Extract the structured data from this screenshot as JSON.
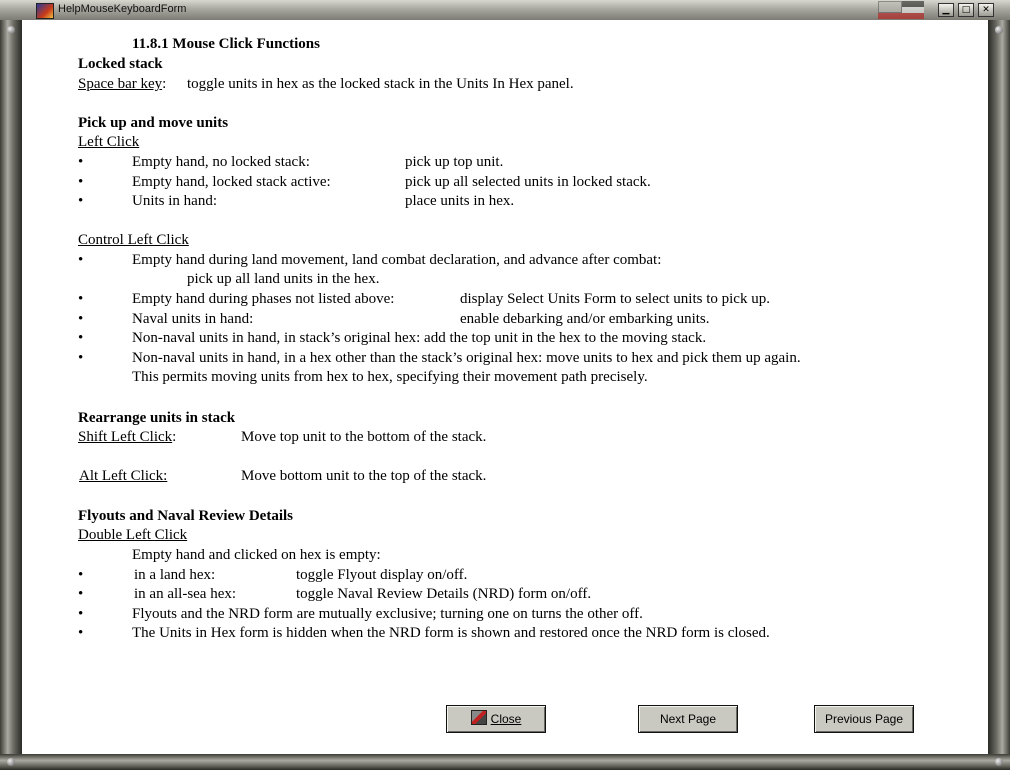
{
  "window": {
    "title": "HelpMouseKeyboardForm",
    "min_icon": "minimize-icon",
    "max_icon": "maximize-icon",
    "close_icon": "close-icon"
  },
  "heading": "11.8.1 Mouse Click Functions",
  "locked_stack": {
    "title": "Locked stack",
    "key": "Space bar key",
    "key_suffix": ":",
    "desc": "toggle units in hex as the locked stack in the Units In Hex panel."
  },
  "pickup": {
    "title": "Pick up and move units",
    "subtitle": "Left Click",
    "rows": [
      {
        "bullet": "•",
        "cond": "Empty hand, no locked stack:",
        "action": "pick up top unit."
      },
      {
        "bullet": "•",
        "cond": "Empty hand, locked stack active:",
        "action": "pick up all selected units in locked stack."
      },
      {
        "bullet": "•",
        "cond": "Units in hand:",
        "action": "place units in hex."
      }
    ]
  },
  "control": {
    "subtitle": "Control Left Click",
    "line1": "Empty hand during  land movement, land combat declaration, and advance after combat:",
    "line1b": "pick up all  land units in the hex.",
    "rows": [
      {
        "bullet": "•",
        "cond": "Empty hand during phases not listed above:",
        "action": "display Select Units Form to select units to pick up."
      },
      {
        "bullet": "•",
        "cond": "Naval units in hand:",
        "action": "enable debarking and/or embarking units."
      }
    ],
    "line4": "Non-naval units in hand, in stack’s original hex: add the top unit in the hex to the moving stack.",
    "line5": "Non-naval units in hand, in a hex other than the stack’s original hex: move units to hex and pick them up again.",
    "line5b": "This permits moving units from hex to hex, specifying their movement path precisely.",
    "bullet": "•"
  },
  "rearrange": {
    "title": "Rearrange units in stack",
    "shift_key": "Shift Left Click",
    "shift_suffix": ":",
    "shift_desc": "Move top unit to the bottom of the stack.",
    "alt_key": "Alt Left Click:",
    "alt_desc": "Move bottom unit to the top of the stack."
  },
  "flyouts": {
    "title": "Flyouts and Naval Review Details",
    "subtitle": "Double Left Click",
    "intro": "Empty hand and clicked on hex is empty:",
    "rows": [
      {
        "bullet": "•",
        "cond": "in a land hex:",
        "action": "toggle Flyout display on/off."
      },
      {
        "bullet": "•",
        "cond": "in an all-sea hex:",
        "action": "toggle Naval Review Details (NRD) form on/off."
      }
    ],
    "line3": "Flyouts and the NRD form are mutually exclusive; turning one on turns the other off.",
    "line4": "The Units in Hex form is hidden when the NRD form is shown and restored once the NRD form is closed.",
    "bullet": "•"
  },
  "buttons": {
    "close": "Close",
    "next": "Next Page",
    "previous": "Previous Page",
    "close_icon": "exit-door-icon"
  }
}
